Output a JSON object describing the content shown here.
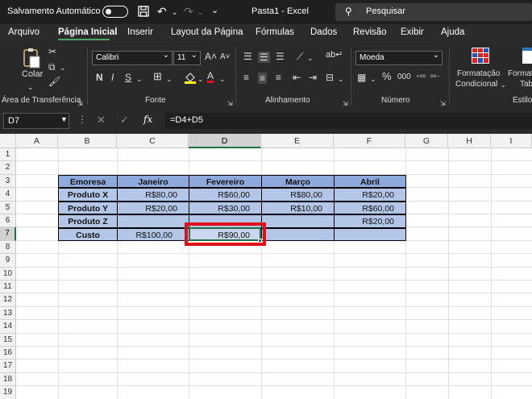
{
  "titlebar": {
    "autosave_label": "Salvamento Automático",
    "document_title": "Pasta1  -  Excel",
    "search_placeholder": "Pesquisar"
  },
  "menu": [
    "Arquivo",
    "Página Inicial",
    "Inserir",
    "Layout da Página",
    "Fórmulas",
    "Dados",
    "Revisão",
    "Exibir",
    "Ajuda"
  ],
  "ribbon": {
    "paste_label": "Colar",
    "clipboard_group": "Área de Transferência",
    "font_name": "Calibri",
    "font_size": "11",
    "bold": "N",
    "italic": "I",
    "underline": "S",
    "font_group": "Fonte",
    "align_group": "Alinhamento",
    "number_format": "Moeda",
    "number_group": "Número",
    "cond_format_line1": "Formatação",
    "cond_format_line2": "Condicional",
    "format_table_line1": "Formata",
    "format_table_line2": "Tab",
    "styles_group": "Estilo"
  },
  "formula_bar": {
    "name_box": "D7",
    "formula": "=D4+D5"
  },
  "sheet": {
    "columns": [
      "A",
      "B",
      "C",
      "D",
      "E",
      "F",
      "G",
      "H",
      "I"
    ],
    "rows": [
      "1",
      "2",
      "3",
      "4",
      "5",
      "6",
      "7",
      "8",
      "9",
      "10",
      "11",
      "12",
      "13",
      "14",
      "15",
      "16",
      "17",
      "18",
      "19"
    ],
    "selected_column": "D",
    "selected_row": "7",
    "table": {
      "headers": [
        "Emoresa",
        "Janeiro",
        "Fevereiro",
        "Março",
        "Abril"
      ],
      "rows": [
        [
          "Produto X",
          "R$80,00",
          "R$60,00",
          "R$80,00",
          "R$20,00"
        ],
        [
          "Produto Y",
          "R$20,00",
          "R$30,00",
          "R$10,00",
          "R$60,00"
        ],
        [
          "Produto Z",
          "",
          "",
          "",
          "R$20,00"
        ],
        [
          "Custo",
          "R$100,00",
          "R$90,00",
          "",
          ""
        ]
      ]
    }
  }
}
